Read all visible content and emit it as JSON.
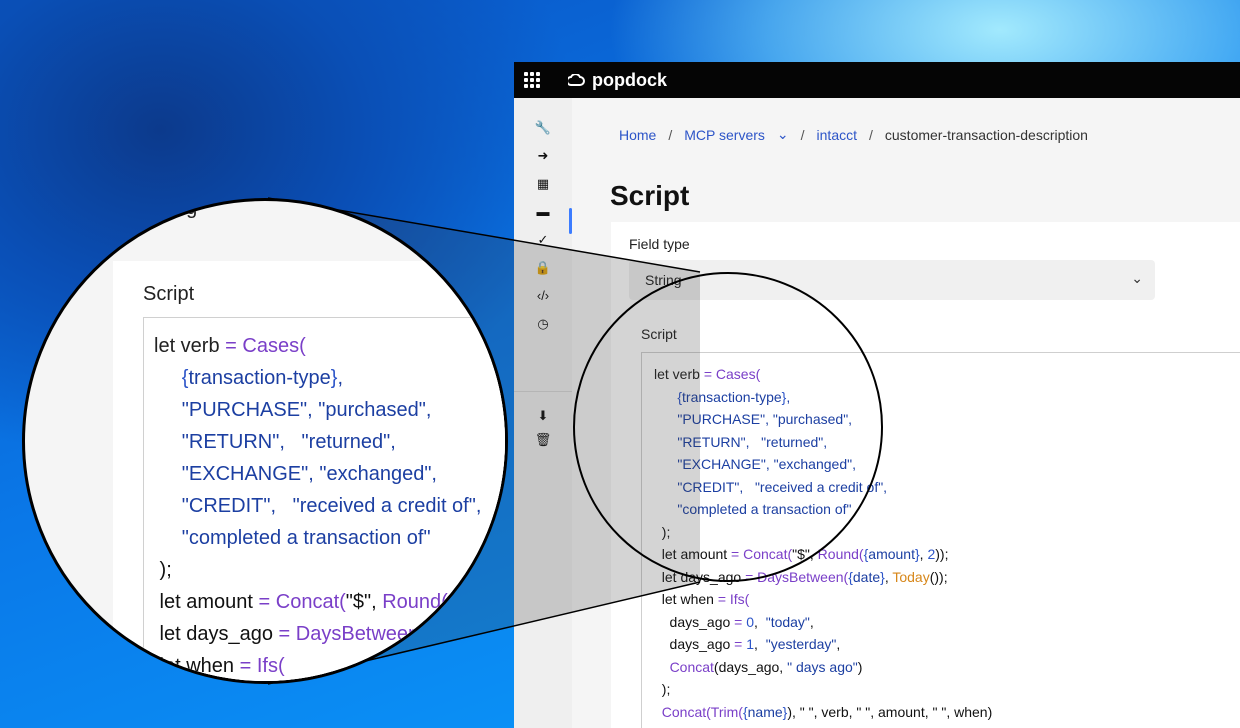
{
  "app": {
    "name": "popdock"
  },
  "breadcrumb": {
    "home": "Home",
    "mcp_servers": "MCP servers",
    "intacct": "intacct",
    "current": "customer-transaction-description"
  },
  "page": {
    "title": "Script"
  },
  "field_type": {
    "label": "Field type",
    "value": "String"
  },
  "script": {
    "label": "Script"
  },
  "rail_icons": [
    "wrench-icon",
    "arrow-right-circle-icon",
    "calculator-icon",
    "window-icon",
    "clipboard-check-icon",
    "lock-icon",
    "code-icon",
    "clock-icon",
    "download-icon",
    "trash-icon"
  ],
  "colors": {
    "accent": "#2d55c8",
    "function": "#7a3fc8",
    "topbar": "#050505",
    "background": "#0b6fd6"
  }
}
